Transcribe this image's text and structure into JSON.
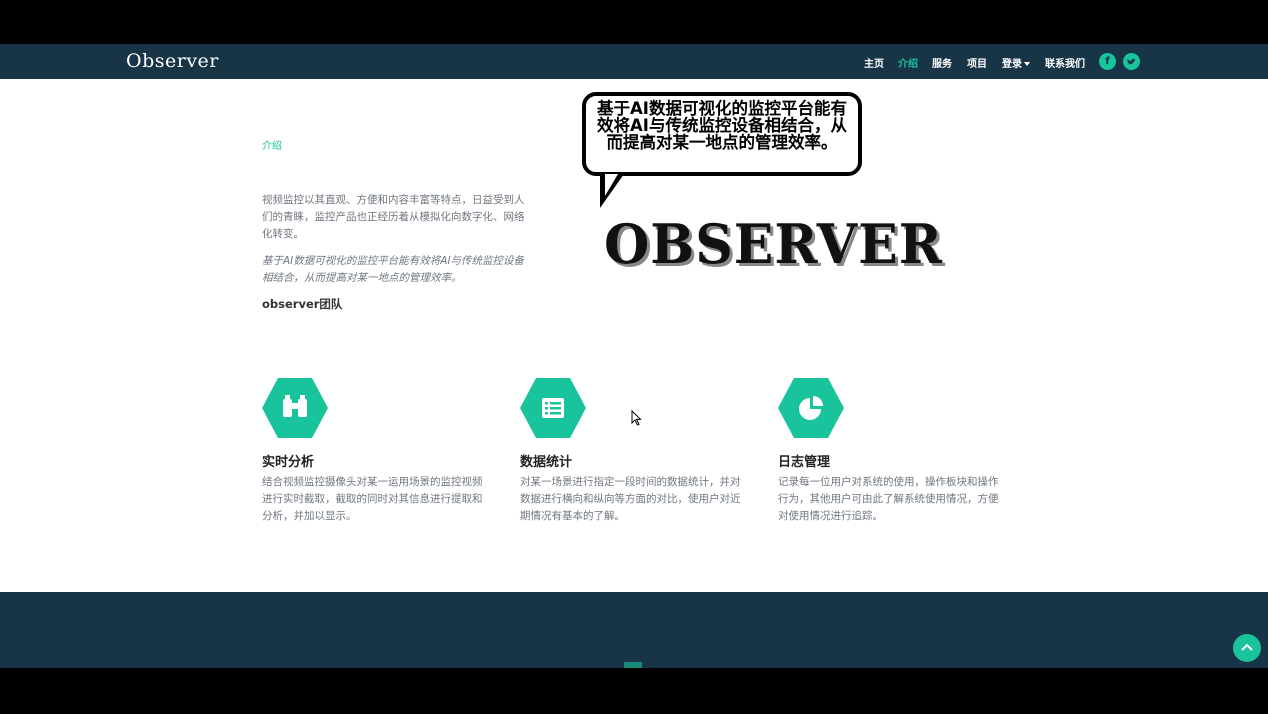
{
  "brand": {
    "logo": "Observer"
  },
  "nav": {
    "home": "主页",
    "intro": "介绍",
    "services": "服务",
    "projects": "项目",
    "login": "登录",
    "contact": "联系我们"
  },
  "social": {
    "facebook": "f",
    "twitter": "twitter-icon"
  },
  "intro": {
    "label": "介绍",
    "paragraph": "视频监控以其直观、方便和内容丰富等特点，日益受到人们的青睐，监控产品也正经历着从模拟化向数字化、网络化转变。",
    "emphasis": "基于AI数据可视化的监控平台能有效将AI与传统监控设备相结合，从而提高对某一地点的管理效率。",
    "team": "observer团队"
  },
  "bubble": {
    "text": "基于AI数据可视化的监控平台能有效将AI与传统监控设备相结合，从而提高对某一地点的管理效率。"
  },
  "hero": {
    "wordmark": "OBSERVER"
  },
  "features": [
    {
      "icon": "binoculars-icon",
      "title": "实时分析",
      "desc": "结合视频监控摄像头对某一运用场景的监控视频进行实时截取，截取的同时对其信息进行提取和分析，并加以显示。"
    },
    {
      "icon": "list-icon",
      "title": "数据统计",
      "desc": "对某一场景进行指定一段时间的数据统计，并对数据进行横向和纵向等方面的对比，使用户对近期情况有基本的了解。"
    },
    {
      "icon": "pie-chart-icon",
      "title": "日志管理",
      "desc": "记录每一位用户对系统的使用，操作板块和操作行为，其他用户可由此了解系统使用情况，方便对使用情况进行追踪。"
    }
  ],
  "colors": {
    "navy": "#183547",
    "accent": "#19c39c"
  }
}
